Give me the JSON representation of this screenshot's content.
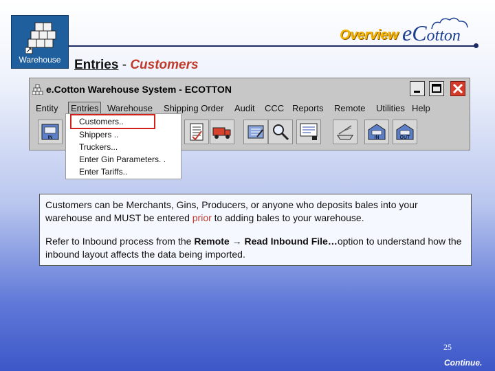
{
  "header": {
    "logo_label": "Warehouse",
    "overview": "Overview",
    "brand_prefix": "e",
    "brand_c": "C",
    "brand_rest": "otton",
    "title_main": "Entries",
    "title_sep": " - ",
    "title_sub": "Customers"
  },
  "window": {
    "title": "e.Cotton Warehouse System - ECOTTON",
    "menu": [
      "Entity",
      "Entries",
      "Warehouse",
      "Shipping Order",
      "Audit",
      "CCC",
      "Reports",
      "Remote",
      "Utilities",
      "Help"
    ],
    "active_menu": "Entries",
    "toolbar_icons": [
      "inbound-icon",
      "checklist-icon",
      "truck-icon",
      "invoice-icon",
      "magnifier-icon",
      "report-icon",
      "scale-icon",
      "warehouse-in-icon",
      "warehouse-out-icon"
    ],
    "toolbar_labels": {
      "in": "IN",
      "out": "OUT"
    }
  },
  "dropdown": {
    "items": [
      "Customers..",
      "Shippers ..",
      "Truckers...",
      "Enter Gin Parameters. .",
      "Enter Tariffs.."
    ],
    "highlighted": "Customers.."
  },
  "info": {
    "p1_a": "Customers can be Merchants, Gins, Producers, or anyone who deposits bales into your warehouse and MUST be entered ",
    "p1_red": "prior",
    "p1_b": " to adding bales to your warehouse.",
    "p2_a": "Refer to Inbound process from the ",
    "p2_b1": "Remote",
    "p2_arrow": " → ",
    "p2_b2": "Read Inbound File…",
    "p2_c": "option to understand how the inbound layout affects the data being imported."
  },
  "footer": {
    "page_number": "25",
    "continue": "Continue."
  },
  "colors": {
    "accent_red": "#c0392b",
    "highlight_red": "#d2201b",
    "overview_gold": "#f4b400",
    "brand_blue": "#1d3f92"
  }
}
